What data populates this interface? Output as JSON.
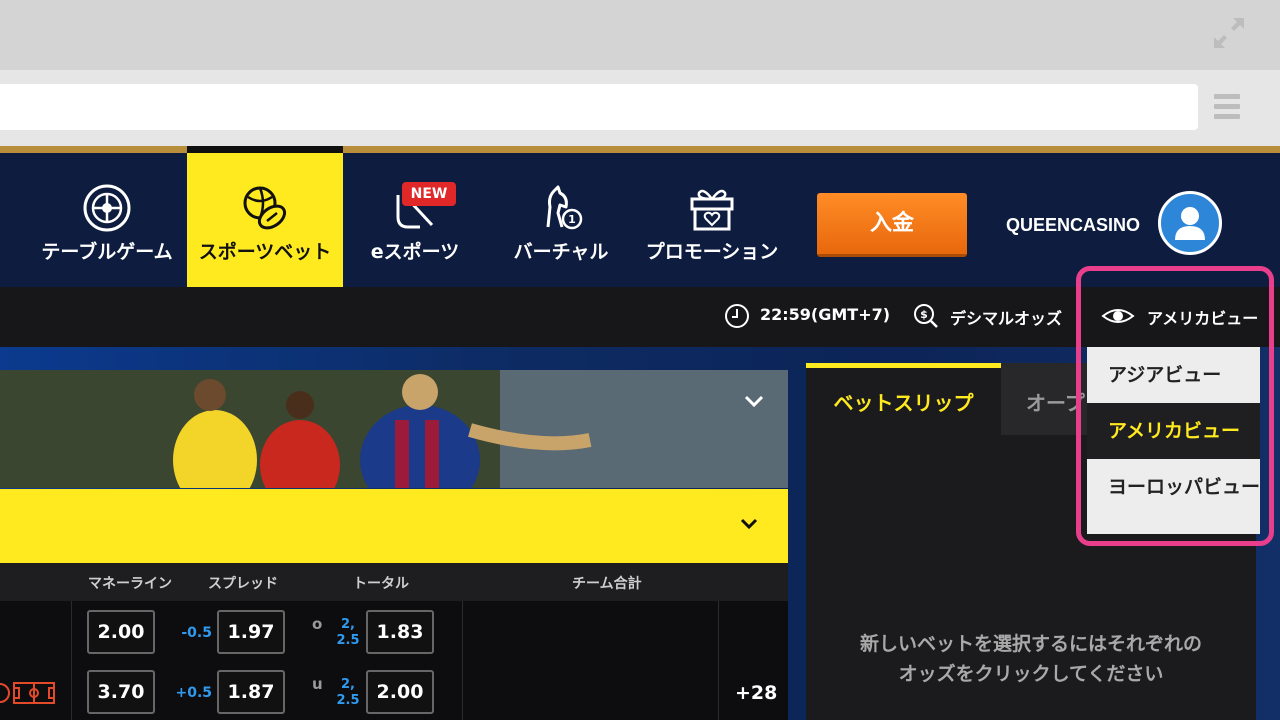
{
  "nav": {
    "items": [
      {
        "label": "テーブルゲーム",
        "icon": "roulette-icon"
      },
      {
        "label": "スポーツベット",
        "icon": "sports-balls-icon",
        "active": true
      },
      {
        "label": "eスポーツ",
        "icon": "esports-controller-icon",
        "badge": "NEW"
      },
      {
        "label": "バーチャル",
        "icon": "virtual-horse-icon"
      },
      {
        "label": "プロモーション",
        "icon": "gift-icon"
      }
    ],
    "deposit_label": "入金",
    "brand": "QUEENCASINO"
  },
  "subbar": {
    "time": "22:59(GMT+7)",
    "odds_format": "デシマルオッズ",
    "view": "アメリカビュー"
  },
  "view_dropdown": {
    "options": [
      "アジアビュー",
      "アメリカビュー",
      "ヨーロッパビュー"
    ],
    "selected": "アメリカビュー"
  },
  "odds_table": {
    "headers": [
      "マネーライン",
      "スプレッド",
      "トータル",
      "チーム合計"
    ],
    "rows": [
      {
        "moneyline": "2.00",
        "spread_line": "-0.5",
        "spread_odds": "1.97",
        "ou": "o",
        "total_line": [
          "2,",
          "2.5"
        ],
        "total_odds": "1.83"
      },
      {
        "moneyline": "3.70",
        "spread_line": "+0.5",
        "spread_odds": "1.87",
        "ou": "u",
        "total_line": [
          "2,",
          "2.5"
        ],
        "total_odds": "2.00"
      }
    ],
    "more_markets": "+28"
  },
  "betslip": {
    "tab_active": "ベットスリップ",
    "tab_other": "オープ",
    "empty_line1": "新しいベットを選択するにはそれぞれの",
    "empty_line2": "オッズをクリックしてください"
  },
  "colors": {
    "accent_yellow": "#ffe91f",
    "nav_bg": "#0e1d3f",
    "deposit_orange": "#f47a1a",
    "highlight_pink": "#e83e8c",
    "line_blue": "#2f9bf0"
  }
}
